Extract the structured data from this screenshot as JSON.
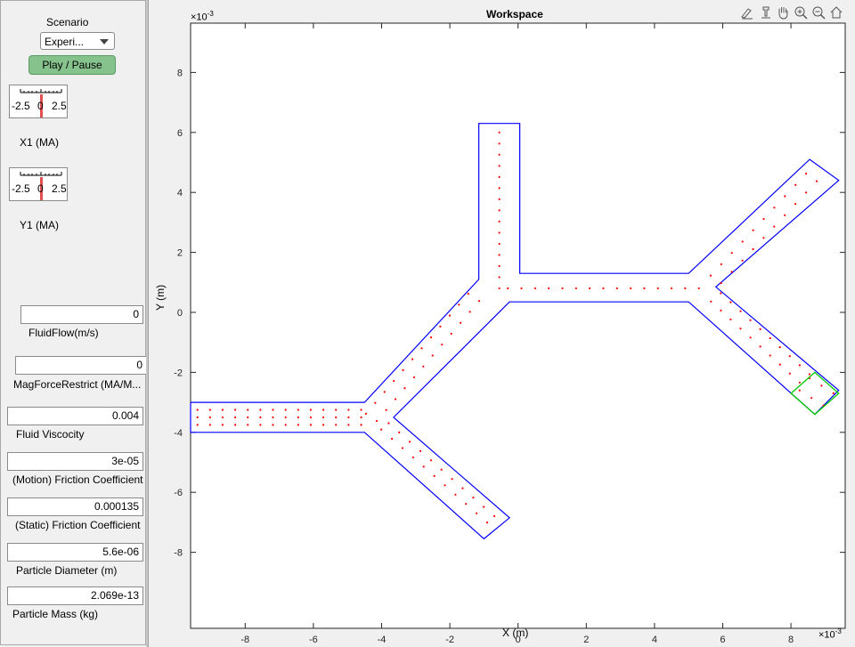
{
  "panel": {
    "scenario_label": "Scenario",
    "scenario_value": "Experi...",
    "play_label": "Play / Pause",
    "knob1": {
      "min_label": "-2.5",
      "mid_label": "0",
      "max_label": "2.5",
      "name": "X1 (MA)"
    },
    "knob2": {
      "min_label": "-2.5",
      "mid_label": "0",
      "max_label": "2.5",
      "name": "Y1 (MA)"
    },
    "fields": {
      "fluidflow": {
        "value": "0",
        "label": "FluidFlow(m/s)"
      },
      "magforce": {
        "value": "0",
        "label": "MagForceRestrict (MA/M..."
      },
      "viscosity": {
        "value": "0.004",
        "label": "Fluid Viscocity"
      },
      "motion_friction": {
        "value": "3e-05",
        "label": "(Motion) Friction Coefficient"
      },
      "static_friction": {
        "value": "0.000135",
        "label": "(Static) Friction Coefficient"
      },
      "diameter": {
        "value": "5.6e-06",
        "label": "Particle Diameter (m)"
      },
      "mass": {
        "value": "2.069e-13",
        "label": "Particle Mass (kg)"
      }
    }
  },
  "plot": {
    "title": "Workspace",
    "xlabel": "X (m)",
    "ylabel": "Y (m)",
    "x_exponent_label": "×10",
    "x_exponent": "-3",
    "y_exponent_label": "×10",
    "y_exponent": "-3",
    "x_ticks": [
      "-8",
      "-6",
      "-4",
      "-2",
      "0",
      "2",
      "4",
      "6",
      "8"
    ],
    "y_ticks": [
      "8",
      "6",
      "4",
      "2",
      "0",
      "-2",
      "-4",
      "-6",
      "-8"
    ],
    "toolbar_icons": [
      "brush-icon",
      "export-icon",
      "pan-hand-icon",
      "zoom-in-icon",
      "zoom-out-icon",
      "home-icon"
    ]
  },
  "colors": {
    "channel": "#0000ff",
    "target": "#00cc00",
    "particles": "#ff0000",
    "play_button": "#86c28c"
  }
}
